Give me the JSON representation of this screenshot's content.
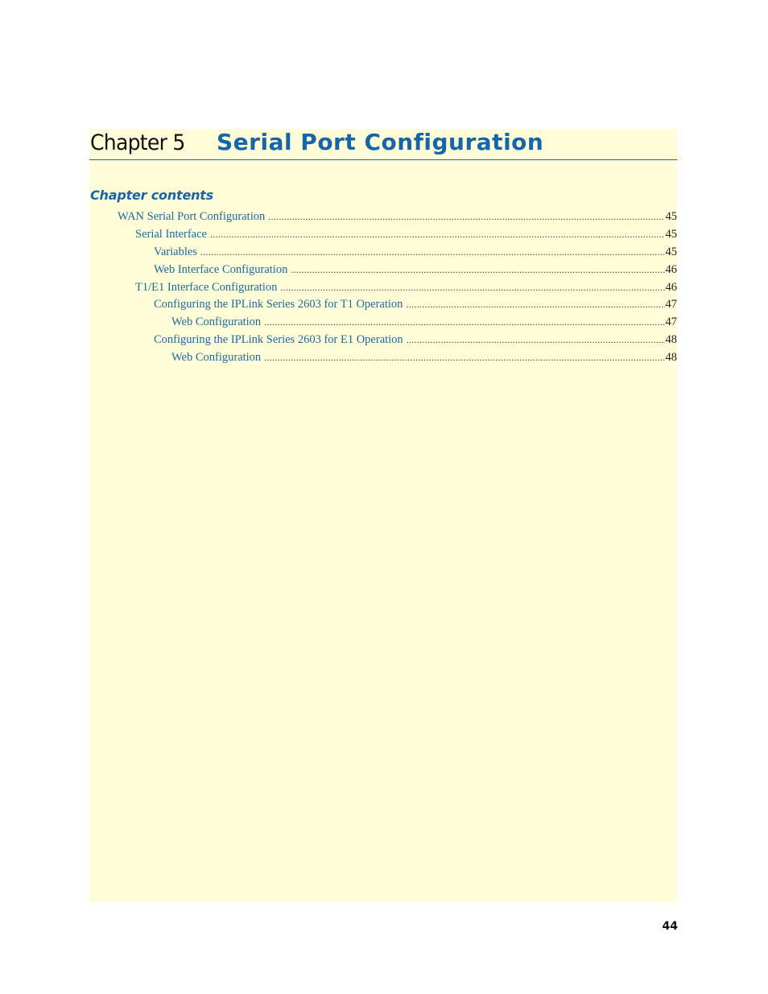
{
  "chapter": {
    "label": "Chapter 5",
    "title": "Serial Port Configuration"
  },
  "contents": {
    "heading": "Chapter contents",
    "entries": [
      {
        "level": 1,
        "label": "WAN Serial Port Configuration",
        "page": "45"
      },
      {
        "level": 2,
        "label": "Serial Interface",
        "page": "45"
      },
      {
        "level": 3,
        "label": "Variables",
        "page": "45"
      },
      {
        "level": 3,
        "label": "Web Interface Configuration",
        "page": "46"
      },
      {
        "level": 2,
        "label": "T1/E1 Interface Configuration",
        "page": "46"
      },
      {
        "level": 3,
        "label": "Configuring the IPLink Series 2603 for T1 Operation",
        "page": "47"
      },
      {
        "level": 4,
        "label": "Web Configuration",
        "page": "47"
      },
      {
        "level": 3,
        "label": "Configuring the IPLink Series 2603 for E1 Operation",
        "page": "48"
      },
      {
        "level": 4,
        "label": "Web Configuration",
        "page": "48"
      }
    ]
  },
  "footer": {
    "page_number": "44"
  },
  "colors": {
    "accent": "#1565a8",
    "panel_background": "#fffdd8",
    "rule": "#1f6f9a"
  }
}
